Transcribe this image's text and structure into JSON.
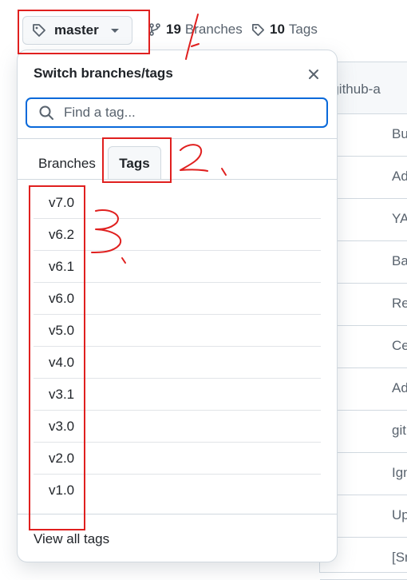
{
  "header": {
    "branch_button_label": "master",
    "branches_count": "19",
    "branches_label": "Branches",
    "tags_count": "10",
    "tags_label": "Tags"
  },
  "background": {
    "path_text": "ant/github-a",
    "rows": [
      "Bu",
      "Ad",
      "YA",
      "Ba",
      "Re",
      "Ce",
      "Ad",
      "git",
      "Ign",
      "Up",
      "[Sn"
    ]
  },
  "panel": {
    "title": "Switch branches/tags",
    "search_placeholder": "Find a tag...",
    "tab_branches": "Branches",
    "tab_tags": "Tags",
    "tags": [
      "v7.0",
      "v6.2",
      "v6.1",
      "v6.0",
      "v5.0",
      "v4.0",
      "v3.1",
      "v3.0",
      "v2.0",
      "v1.0"
    ],
    "view_all": "View all tags"
  },
  "annotations": {
    "marks": [
      "1",
      "2",
      "3"
    ],
    "color": "#e0201f"
  },
  "colors": {
    "accent": "#0969da",
    "border": "#d1d9e0",
    "muted_text": "#59636e",
    "annotation": "#e0201f"
  }
}
